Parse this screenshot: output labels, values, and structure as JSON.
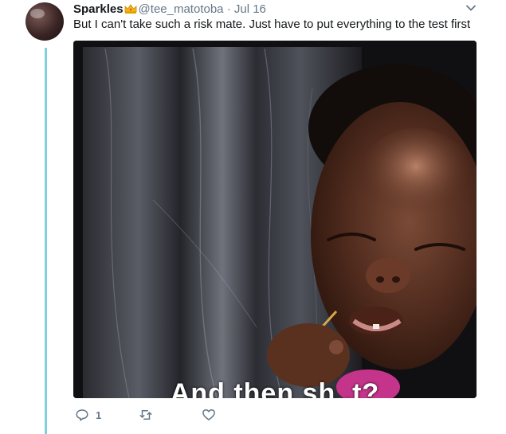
{
  "tweet": {
    "display_name": "Sparkles",
    "handle": "@tee_matotoba",
    "separator": "·",
    "date": "Jul 16",
    "text": "But I can't take such a risk mate. Just have to put everything to the test first",
    "media": {
      "caption_partial": "And then sh..t?"
    },
    "actions": {
      "reply_count": "1",
      "reply_icon": "reply-icon",
      "retweet_icon": "retweet-icon",
      "like_icon": "heart-icon"
    },
    "menu_icon": "chevron-down-icon",
    "crown_icon": "crown-emoji"
  },
  "colors": {
    "thread_line": "#7fd0e0",
    "secondary_text": "#657786",
    "crown": "#f5b617"
  }
}
